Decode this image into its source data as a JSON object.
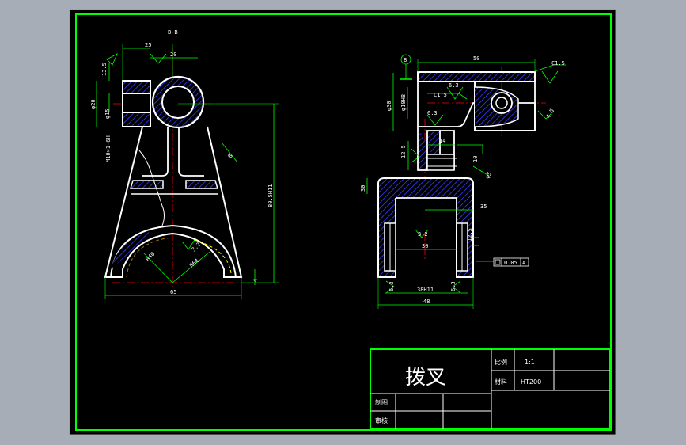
{
  "drawing": {
    "section_label": "B-B",
    "left_view": {
      "dims": {
        "top_width": "25",
        "bore": "20",
        "flange_thickness": "13.5",
        "bore_dia": "φ20",
        "hole_dia": "φ15",
        "slot_tol": "M10×1-6H",
        "height": "80.5H11",
        "rib": "8",
        "r_inner": "R40",
        "r_outer": "R64",
        "bottom_width": "65",
        "foot": "4"
      },
      "roughness": [
        "3.2",
        "6.3"
      ]
    },
    "right_view": {
      "datum": "B",
      "dims": {
        "top_width": "50",
        "chamfer_top": "C1.5",
        "chamfer_left": "C1.5",
        "roughness_a": "6.3",
        "roughness_b": "6.3",
        "roughness_c": "12.5",
        "hole_dia": "φ10H8",
        "outer_dia": "φ30",
        "step": "14",
        "angle": "12.5",
        "slot_h": "10",
        "w_inner": "30",
        "w_slot": "30",
        "w_fork": "38H11",
        "w_total": "48",
        "side_dia": "φ5",
        "fork_depth": "35",
        "roughness_d": "3.2",
        "roughness_e": "6.3",
        "roughness_f": "6.3",
        "tol_value": "0.05",
        "tol_ref": "A",
        "roughness_g": "4.5"
      }
    }
  },
  "title_block": {
    "title": "拨叉",
    "scale_label": "比例",
    "scale_value": "1:1",
    "material_label": "材料",
    "material_value": "HT200",
    "drawn_label": "制图",
    "review_label": "审核"
  },
  "colors": {
    "background": "#a7adb6",
    "sheet": "#000000",
    "frame": "#00ff00",
    "outline": "#ffffff",
    "dimension": "#00ff00",
    "centerline": "#ff0000",
    "hatch": "#3c3cff"
  }
}
